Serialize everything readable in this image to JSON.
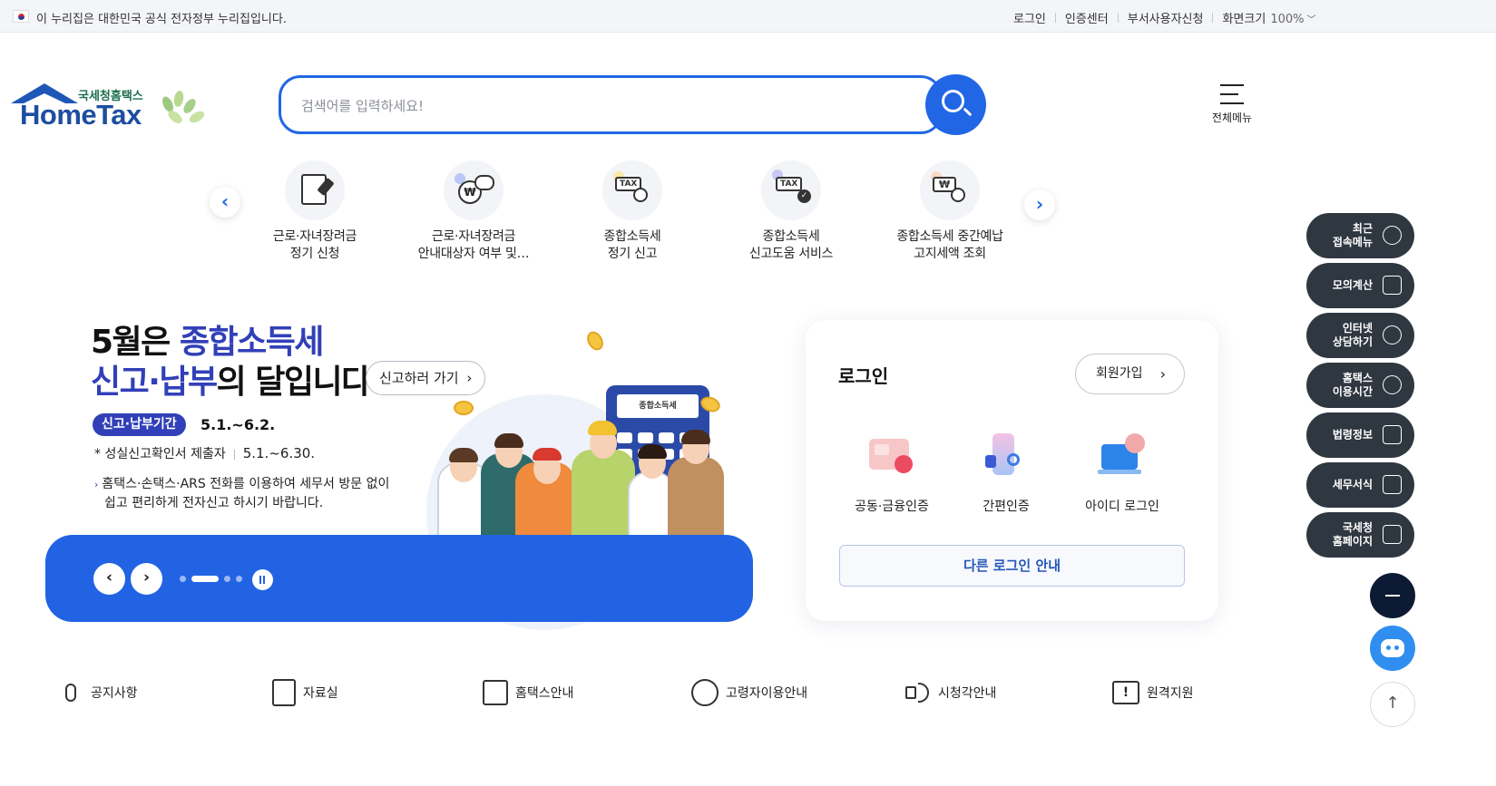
{
  "gov_bar": {
    "text": "이 누리집은 대한민국 공식 전자정부 누리집입니다.",
    "links": [
      "로그인",
      "인증센터",
      "부서사용자신청",
      "화면크기"
    ],
    "zoom": "100%"
  },
  "logo": {
    "subtitle": "국세청홈택스",
    "name": "HomeTax"
  },
  "search": {
    "placeholder": "검색어를 입력하세요!"
  },
  "all_menu": {
    "label": "전체메뉴"
  },
  "quick_services": [
    {
      "line1": "근로·자녀장려금",
      "line2": "정기 신청",
      "icon": "form-pen-icon"
    },
    {
      "line1": "근로·자녀장려금",
      "line2": "안내대상자 여부 및…",
      "icon": "money-chat-icon"
    },
    {
      "line1": "종합소득세",
      "line2": "정기 신고",
      "icon": "tax-search-icon"
    },
    {
      "line1": "종합소득세",
      "line2": "신고도움 서비스",
      "icon": "tax-check-icon"
    },
    {
      "line1": "종합소득세 중간예납",
      "line2": "고지세액 조회",
      "icon": "won-search-icon"
    }
  ],
  "banner": {
    "title_a": "5월은 ",
    "title_b": "종합소득세",
    "title_c": "신고·납부",
    "title_d": "의 달입니다.",
    "go_label": "신고하러 가기",
    "period_label": "신고·납부기간",
    "period_date": "5.1.~6.2.",
    "conf_label": "성실신고확인서 제출자",
    "conf_date": "5.1.~6.30.",
    "desc_line1": "홈택스·손택스·ARS 전화를 이용하여 세무서 방문 없이",
    "desc_line2": "쉽고 편리하게 전자신고 하시기 바랍니다.",
    "calc_label": "종합소득세",
    "slides_total": 4,
    "slide_active": 2
  },
  "login": {
    "title": "로그인",
    "join_label": "회원가입",
    "options": [
      "공동·금융인증",
      "간편인증",
      "아이디 로그인"
    ],
    "other_label": "다른 로그인 안내"
  },
  "float_menu": [
    {
      "line1": "최근",
      "line2": "접속메뉴",
      "icon": "clock-icon"
    },
    {
      "line1": "모의계산",
      "line2": "",
      "icon": "calculator-icon"
    },
    {
      "line1": "인터넷",
      "line2": "상담하기",
      "icon": "chat-icon"
    },
    {
      "line1": "홈택스",
      "line2": "이용시간",
      "icon": "alarm-icon"
    },
    {
      "line1": "법령정보",
      "line2": "",
      "icon": "gavel-icon"
    },
    {
      "line1": "세무서식",
      "line2": "",
      "icon": "document-icon"
    },
    {
      "line1": "국세청",
      "line2": "홈페이지",
      "icon": "building-icon"
    }
  ],
  "bottom_links": [
    "공지사항",
    "자료실",
    "홈택스안내",
    "고령자이용안내",
    "시청각안내",
    "원격지원"
  ],
  "colors": {
    "primary": "#2166e5",
    "banner_accent": "#3140b8",
    "float_bg": "#2f3740"
  }
}
